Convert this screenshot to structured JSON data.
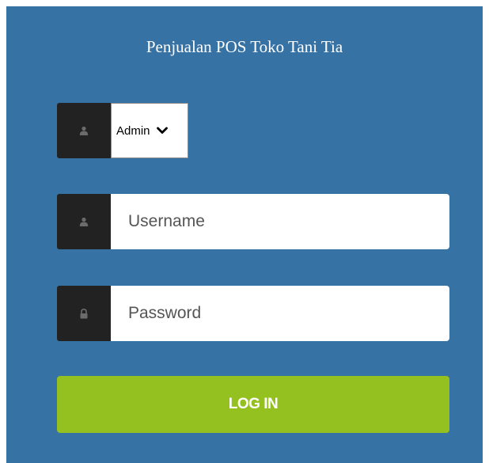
{
  "app": {
    "title": "Penjualan POS Toko Tani Tia"
  },
  "role_select": {
    "selected": "Admin",
    "icon": "user-icon"
  },
  "username": {
    "placeholder": "Username",
    "icon": "user-icon"
  },
  "password": {
    "placeholder": "Password",
    "icon": "lock-icon"
  },
  "login_button": {
    "label": "LOG IN"
  },
  "colors": {
    "panel_background": "#3772a4",
    "icon_box": "#222222",
    "login_button": "#94c11f",
    "icon_glyph": "#6b6b6b"
  }
}
